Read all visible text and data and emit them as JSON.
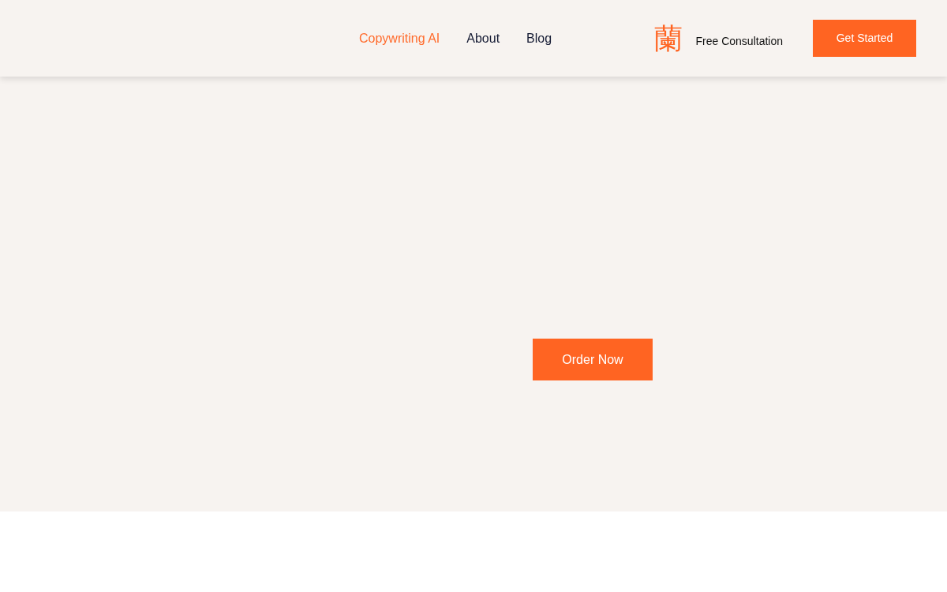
{
  "header": {
    "nav": [
      {
        "label": "Copywriting AI",
        "selected": true
      },
      {
        "label": "About",
        "selected": false
      },
      {
        "label": "Blog",
        "selected": false
      }
    ],
    "brand_glyph": "蘭",
    "consultation_link": "Free Consultation",
    "cta_button": "Get Started"
  },
  "hero": {
    "button": "Order Now"
  }
}
